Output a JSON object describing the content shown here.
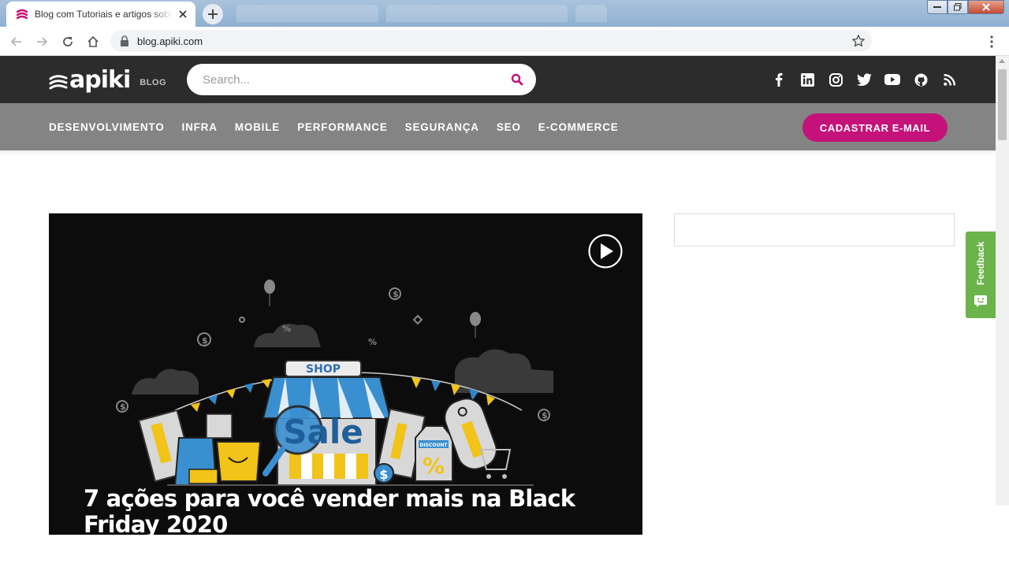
{
  "browser": {
    "tab_title": "Blog com Tutoriais e artigos sobre",
    "url": "blog.apiki.com"
  },
  "site": {
    "logo_text": "apiki",
    "logo_sub": "BLOG",
    "search_placeholder": "Search...",
    "social_icons": [
      "facebook-icon",
      "linkedin-icon",
      "instagram-icon",
      "twitter-icon",
      "youtube-icon",
      "github-icon",
      "rss-icon"
    ],
    "menu": [
      "DESENVOLVIMENTO",
      "INFRA",
      "MOBILE",
      "PERFORMANCE",
      "SEGURANÇA",
      "SEO",
      "E-COMMERCE"
    ],
    "cta_label": "CADASTRAR E-MAIL"
  },
  "hero": {
    "title": "7 ações para você vender mais na Black Friday 2020",
    "art_labels": {
      "shop": "SHOP",
      "sale": "Sale",
      "discount": "DISCOUNT",
      "percent": "%"
    }
  },
  "feedback": {
    "label": "Feedback"
  },
  "colors": {
    "brand": "#c4127a",
    "topbar": "#2c2c2c",
    "navbar": "#848484",
    "feedback": "#6bb34a"
  }
}
